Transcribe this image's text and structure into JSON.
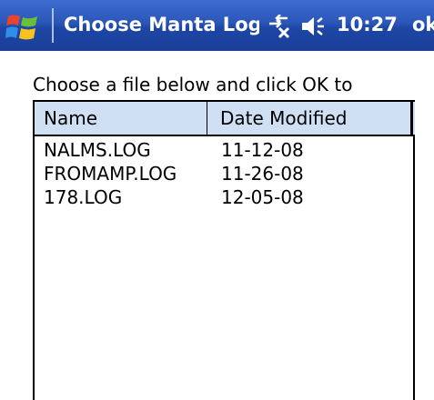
{
  "title_bar": {
    "title": "Choose Manta Log File",
    "clock": "10:27",
    "ok_label": "ok",
    "icons": {
      "start": "windows-start-flag-icon",
      "connectivity": "connectivity-off-icon",
      "volume": "volume-icon"
    }
  },
  "instructions": "Choose a file below and click OK to",
  "file_list": {
    "columns": {
      "name": "Name",
      "date": "Date Modified"
    },
    "rows": [
      {
        "name": "NALMS.LOG",
        "date": "11-12-08"
      },
      {
        "name": "FROMAMP.LOG",
        "date": "11-26-08"
      },
      {
        "name": "178.LOG",
        "date": "12-05-08"
      }
    ]
  },
  "colors": {
    "title_bar": "#2a56b8",
    "header_bg": "#cfe0f4",
    "text": "#000000"
  }
}
